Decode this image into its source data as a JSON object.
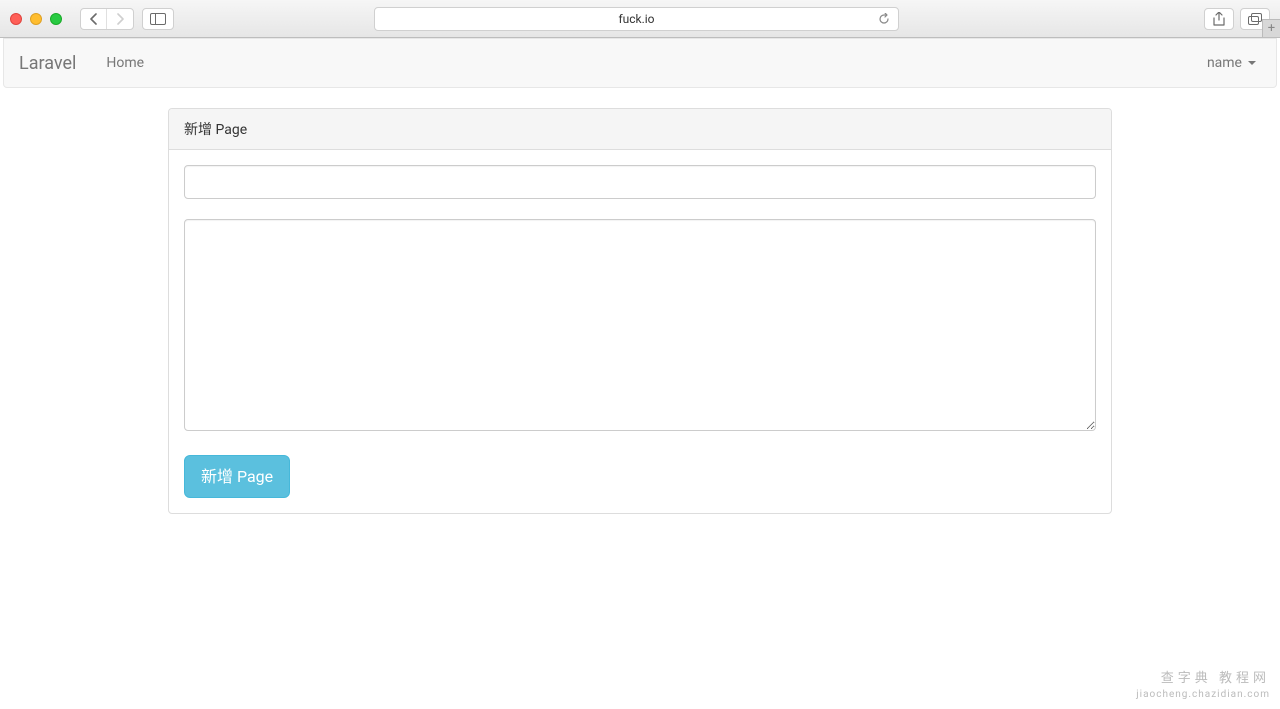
{
  "browser": {
    "url": "fuck.io"
  },
  "navbar": {
    "brand": "Laravel",
    "home_link": "Home",
    "user_name": "name"
  },
  "panel": {
    "heading": "新增 Page"
  },
  "form": {
    "title_value": "",
    "body_value": "",
    "submit_label": "新增 Page"
  },
  "watermark": {
    "line1": "查字典 教程网",
    "line2": "jiaocheng.chazidian.com"
  }
}
